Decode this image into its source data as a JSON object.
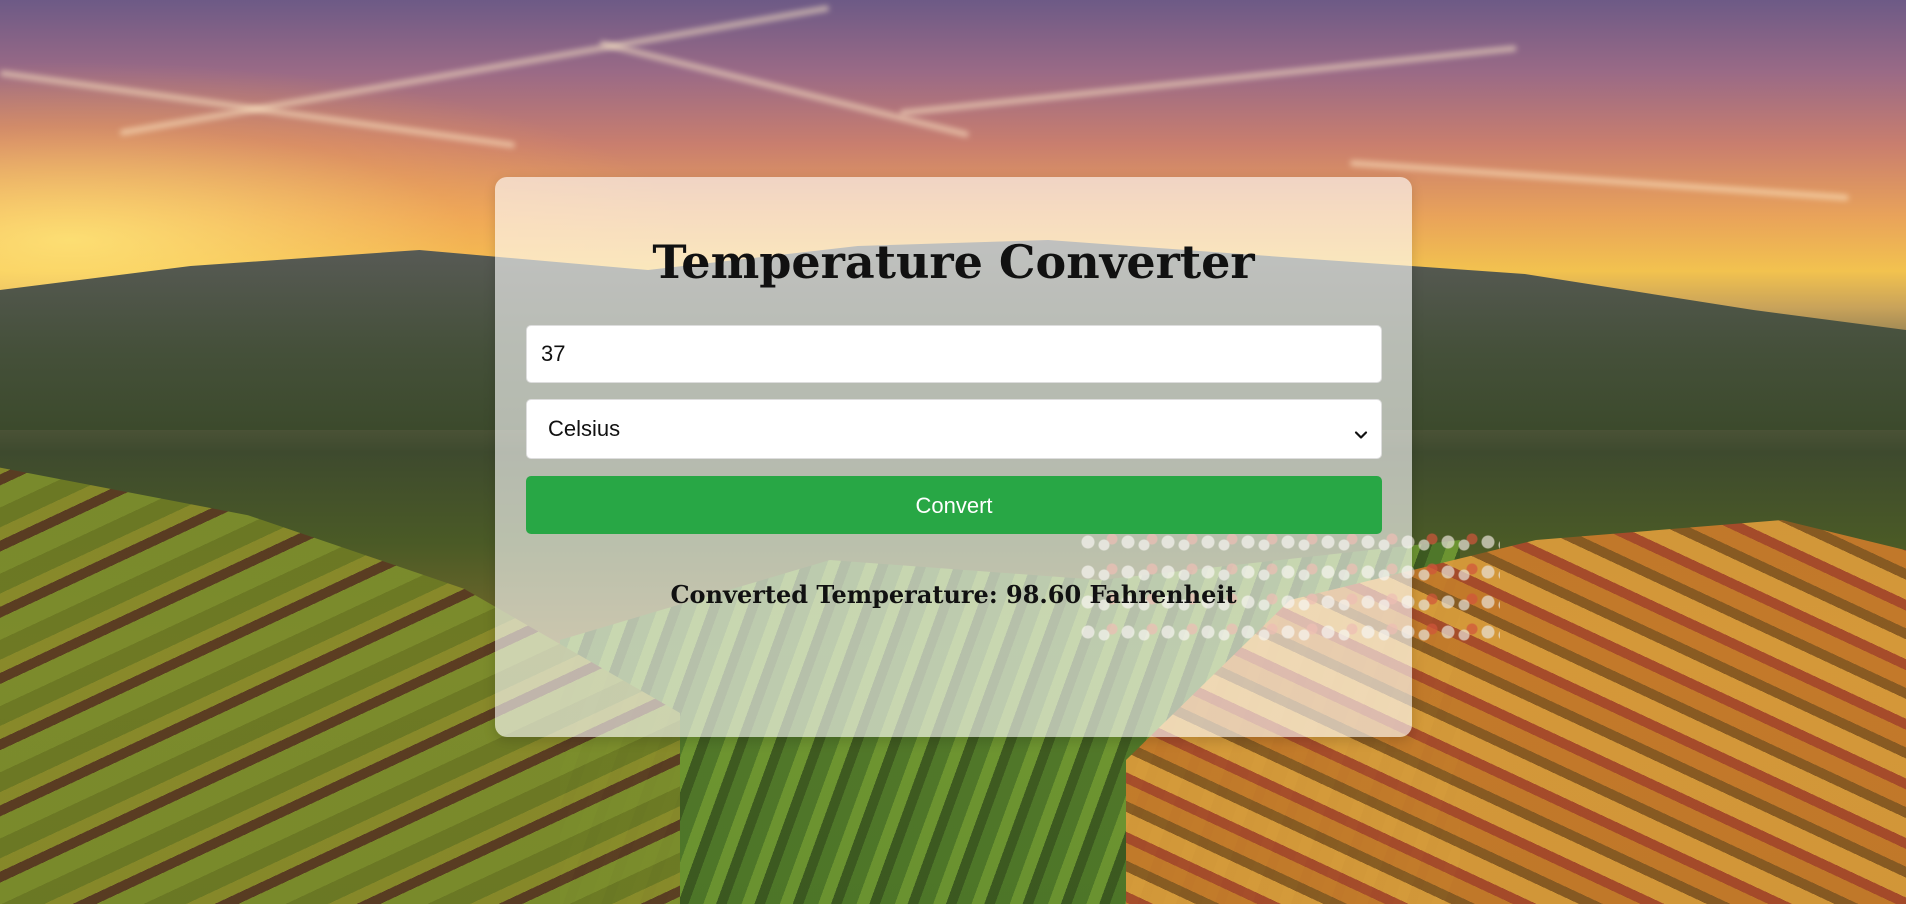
{
  "app": {
    "title": "Temperature Converter"
  },
  "form": {
    "temperature_value": "37",
    "unit_selected": "Celsius",
    "convert_label": "Convert"
  },
  "result": {
    "text": "Converted Temperature: 98.60 Fahrenheit"
  },
  "colors": {
    "convert_button": "#28a745",
    "card_background": "rgba(255,255,255,0.62)"
  },
  "icons": {
    "select_arrow": "chevron-down-icon"
  }
}
